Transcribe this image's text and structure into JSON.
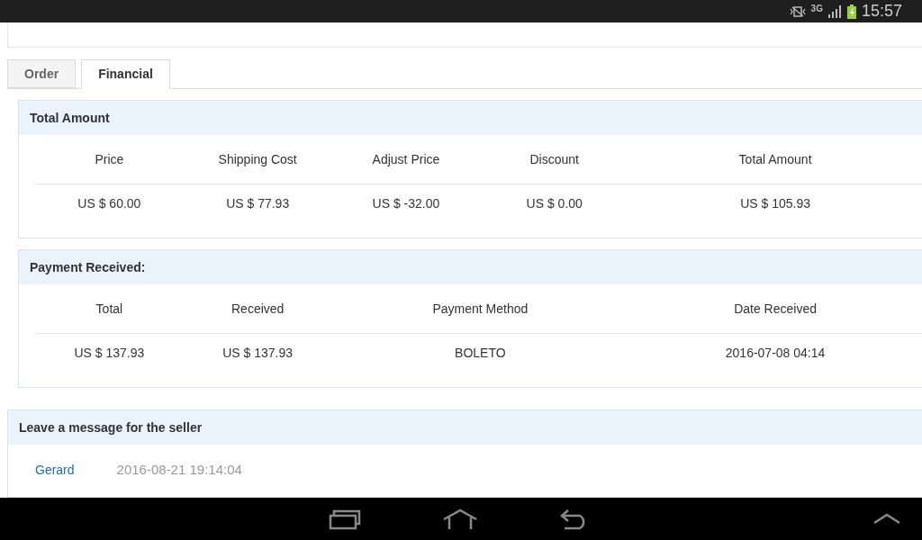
{
  "status_bar": {
    "network": "3G",
    "time": "15:57"
  },
  "tabs": [
    {
      "label": "Order",
      "selected": false
    },
    {
      "label": "Financial",
      "selected": true
    }
  ],
  "total_amount": {
    "title": "Total Amount",
    "columns": [
      "Price",
      "Shipping Cost",
      "Adjust Price",
      "Discount",
      "Total Amount"
    ],
    "rows": [
      [
        "US $ 60.00",
        "US $ 77.93",
        "US $ -32.00",
        "US $ 0.00",
        "US $ 105.93"
      ]
    ]
  },
  "payment_received": {
    "title": "Payment Received:",
    "columns": [
      "Total",
      "Received",
      "Payment Method",
      "Date Received"
    ],
    "rows": [
      [
        "US $ 137.93",
        "US $ 137.93",
        "BOLETO",
        "2016-07-08 04:14"
      ]
    ]
  },
  "messages": {
    "title": "Leave a message for the seller",
    "items": [
      {
        "author": "Gerard",
        "time": "2016-08-21 19:14:04"
      }
    ]
  }
}
